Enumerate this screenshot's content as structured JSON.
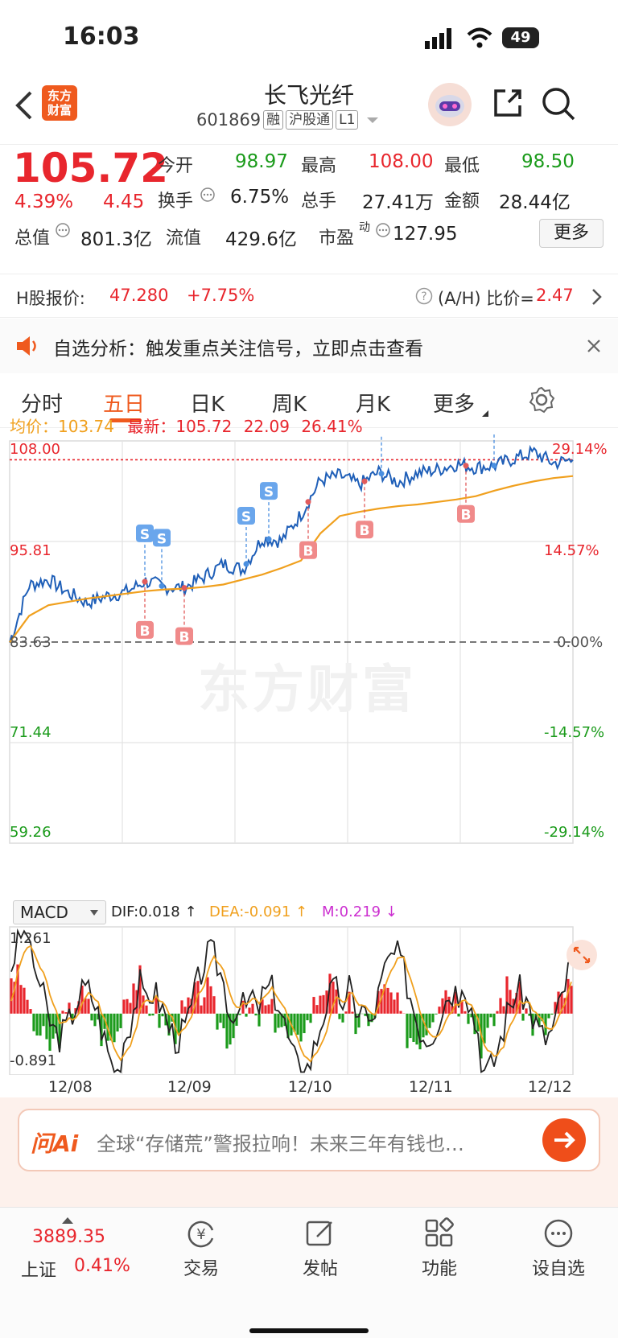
{
  "status": {
    "time": "16:03",
    "battery": "49"
  },
  "header": {
    "logo_line1": "东方",
    "logo_line2": "财富",
    "stock_name": "长飞光纤",
    "code": "601869",
    "chips": [
      "融",
      "沪股通",
      "L1"
    ]
  },
  "quote": {
    "price": "105.72",
    "change_pct": "4.39%",
    "change": "4.45",
    "open_label": "今开",
    "open": "98.97",
    "high_label": "最高",
    "high": "108.00",
    "low_label": "最低",
    "low": "98.50",
    "turnover_label": "换手",
    "turnover": "6.75%",
    "volume_label": "总手",
    "volume": "27.41万",
    "amount_label": "金额",
    "amount": "28.44亿",
    "mktcap_label": "总值",
    "mktcap": "801.3亿",
    "float_label": "流值",
    "float": "429.6亿",
    "pe_label": "市盈",
    "pe_sup": "动",
    "pe": "127.95",
    "more": "更多"
  },
  "hshare": {
    "label": "H股报价:",
    "price": "47.280",
    "pct": "+7.75%",
    "ratio_label": "(A/H) 比价=",
    "ratio": "2.47"
  },
  "alert": {
    "text": "自选分析：触发重点关注信号，立即点击查看"
  },
  "tabs": [
    "分时",
    "五日",
    "日K",
    "周K",
    "月K",
    "更多"
  ],
  "chart_info": {
    "avg_label": "均价：",
    "avg": "103.74",
    "latest_label": "最新：",
    "latest": "105.72",
    "change": "22.09",
    "pct": "26.41%"
  },
  "watermark": "东方财富",
  "macd": {
    "name": "MACD",
    "dif": "DIF:0.018 ↑",
    "dea": "DEA:-0.091 ↑",
    "m": "M:0.219 ↓",
    "ymax": "1.261",
    "ymin": "-0.891"
  },
  "ai": {
    "logo": "问Ai",
    "text": "全球“存储荒”警报拉响！未来三年有钱也…"
  },
  "bottom": {
    "index_value": "3889.35",
    "index_name": "上证",
    "index_pct": "0.41%",
    "items": [
      "交易",
      "发帖",
      "功能",
      "设自选"
    ]
  },
  "colors": {
    "up": "#e8262d",
    "down": "#1b9b1b",
    "accent": "#ef5a1e",
    "price_line": "#1f5fb8",
    "avg_line": "#f0a01e"
  },
  "chart_data": {
    "type": "line",
    "x_labels": [
      "12/08",
      "12/09",
      "12/10",
      "12/11",
      "12/12"
    ],
    "y_left_ticks": [
      "108.00",
      "95.81",
      "83.63",
      "71.44",
      "59.26"
    ],
    "y_right_ticks": [
      "29.14%",
      "14.57%",
      "0.00%",
      "-14.57%",
      "-29.14%"
    ],
    "ylim": [
      59.26,
      108.0
    ],
    "prev_close": 83.63,
    "series": [
      {
        "values": [
          83.6,
          90.5,
          91.2,
          89.6,
          88.4,
          89.2,
          89.7,
          91.0,
          90.3,
          90.2,
          91.5,
          93.1,
          92.4,
          96.2,
          95.9,
          99.1,
          103.2,
          103.8,
          102.7,
          104.2,
          103.0,
          104.1,
          104.5,
          105.2,
          104.8,
          105.0,
          105.9,
          106.6,
          105.3,
          105.7
        ]
      },
      {
        "values": [
          83.6,
          86.8,
          88.1,
          88.5,
          88.9,
          89.2,
          89.5,
          89.8,
          90.0,
          90.1,
          90.3,
          90.6,
          91.2,
          91.8,
          92.6,
          93.5,
          96.8,
          98.9,
          99.4,
          99.8,
          100.1,
          100.3,
          100.6,
          100.9,
          101.3,
          102.0,
          102.6,
          103.1,
          103.5,
          103.74
        ]
      }
    ],
    "markers": [
      {
        "type": "S",
        "x": 0.24
      },
      {
        "type": "S",
        "x": 0.27
      },
      {
        "type": "B",
        "x": 0.24
      },
      {
        "type": "B",
        "x": 0.31
      },
      {
        "type": "S",
        "x": 0.42
      },
      {
        "type": "S",
        "x": 0.46
      },
      {
        "type": "B",
        "x": 0.53
      },
      {
        "type": "B",
        "x": 0.63
      },
      {
        "type": "S",
        "x": 0.66
      },
      {
        "type": "B",
        "x": 0.81
      },
      {
        "type": "S",
        "x": 0.86
      }
    ]
  }
}
